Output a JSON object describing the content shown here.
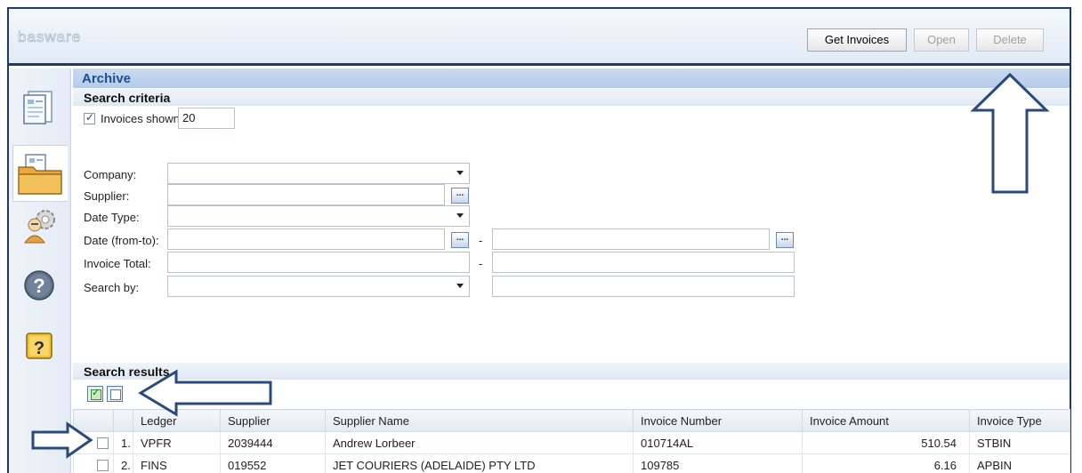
{
  "header": {
    "logo": "basware",
    "get_invoices_label": "Get Invoices",
    "open_label": "Open",
    "delete_label": "Delete"
  },
  "sidebar": {
    "items": [
      {
        "icon": "document-icon"
      },
      {
        "icon": "archive-folder-icon",
        "active": true
      },
      {
        "icon": "admin-settings-icon"
      },
      {
        "icon": "help-icon"
      },
      {
        "icon": "key-icon"
      }
    ]
  },
  "archive": {
    "title": "Archive"
  },
  "search_criteria": {
    "title": "Search criteria",
    "invoices_shown_label": "Invoices shown",
    "invoices_shown_checked": true,
    "invoices_shown_value": "20",
    "fields": {
      "company_label": "Company:",
      "supplier_label": "Supplier:",
      "date_type_label": "Date Type:",
      "date_from_to_label": "Date (from-to):",
      "invoice_total_label": "Invoice Total:",
      "search_by_label": "Search by:"
    },
    "dash": "-",
    "browse_label": "..."
  },
  "search_results": {
    "title": "Search results",
    "columns": [
      "",
      "",
      "Ledger",
      "Supplier",
      "Supplier Name",
      "Invoice Number",
      "Invoice Amount",
      "Invoice Type"
    ],
    "rows": [
      {
        "num": "1.",
        "ledger": "VPFR",
        "supplier": "2039444",
        "supplier_name": "Andrew Lorbeer",
        "invoice_number": "010714AL",
        "invoice_amount": "510.54",
        "invoice_type": "STBIN"
      },
      {
        "num": "2.",
        "ledger": "FINS",
        "supplier": "019552",
        "supplier_name": "JET COURIERS (ADELAIDE) PTY LTD",
        "invoice_number": "109785",
        "invoice_amount": "6.16",
        "invoice_type": "APBIN"
      }
    ]
  },
  "colors": {
    "frame": "#1d3a6b",
    "title_text": "#1d4e8f",
    "arrow_stroke": "#2b4a7c"
  }
}
